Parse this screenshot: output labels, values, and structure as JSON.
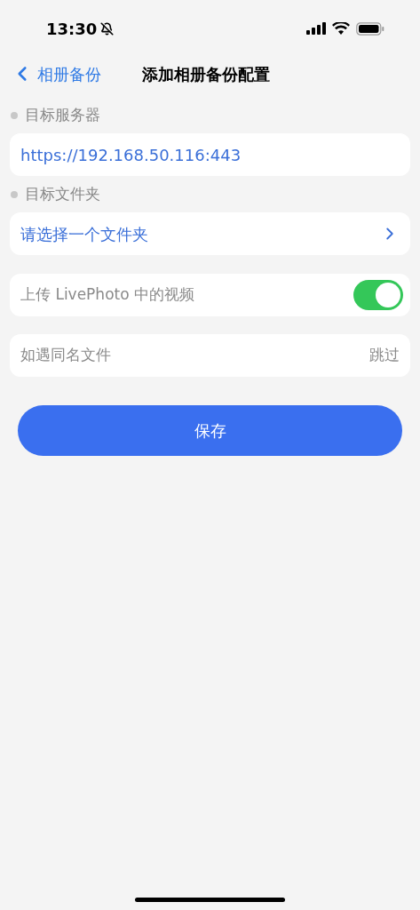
{
  "status_bar": {
    "time": "13:30",
    "silent": true
  },
  "nav": {
    "back_label": "相册备份",
    "title": "添加相册备份配置"
  },
  "sections": [
    {
      "label": "目标服务器",
      "kind": "value",
      "value": "https://192.168.50.116:443"
    },
    {
      "label": "目标文件夹",
      "kind": "link",
      "value": "请选择一个文件夹"
    }
  ],
  "settings": [
    {
      "kind": "toggle",
      "label": "上传 LivePhoto 中的视频",
      "on": true
    },
    {
      "kind": "option",
      "label": "如遇同名文件",
      "value": "跳过"
    }
  ],
  "save_button": "保存"
}
